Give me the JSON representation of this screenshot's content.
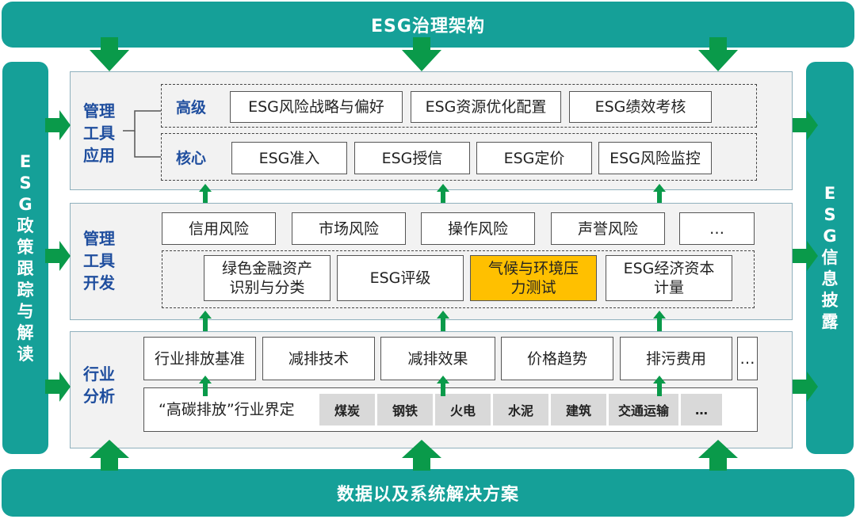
{
  "top_bar": "ESG治理架构",
  "bottom_bar": "数据以及系统解决方案",
  "left_sidebar": [
    "E",
    "S",
    "G",
    "政",
    "策",
    "跟",
    "踪",
    "与",
    "解",
    "读"
  ],
  "right_sidebar": [
    "E",
    "S",
    "G",
    "信",
    "息",
    "披",
    "露"
  ],
  "app_panel": {
    "label": [
      "管理",
      "工具",
      "应用"
    ],
    "high": {
      "label": "高级",
      "items": [
        "ESG风险战略与偏好",
        "ESG资源优化配置",
        "ESG绩效考核"
      ]
    },
    "core": {
      "label": "核心",
      "items": [
        "ESG准入",
        "ESG授信",
        "ESG定价",
        "ESG风险监控"
      ]
    }
  },
  "dev_panel": {
    "label": [
      "管理",
      "工具",
      "开发"
    ],
    "risks": [
      "信用风险",
      "市场风险",
      "操作风险",
      "声誉风险",
      "…"
    ],
    "tools": [
      {
        "text": [
          "绿色金融资产",
          "识别与分类"
        ],
        "highlight": false
      },
      {
        "text": [
          "ESG评级"
        ],
        "highlight": false
      },
      {
        "text": [
          "气候与环境压",
          "力测试"
        ],
        "highlight": true
      },
      {
        "text": [
          "ESG经济资本",
          "计量"
        ],
        "highlight": false
      }
    ]
  },
  "industry_panel": {
    "label": [
      "行业",
      "分析"
    ],
    "items": [
      "行业排放基准",
      "减排技术",
      "减排效果",
      "价格趋势",
      "排污费用",
      "…"
    ],
    "definition_label": "“高碳排放”行业界定",
    "sectors": [
      "煤炭",
      "钢铁",
      "火电",
      "水泥",
      "建筑",
      "交通运输",
      "…"
    ]
  },
  "colors": {
    "teal": "#15a098",
    "arrow_green": "#0a9a4a",
    "label_blue": "#1f4e9e",
    "highlight": "#ffc000"
  }
}
